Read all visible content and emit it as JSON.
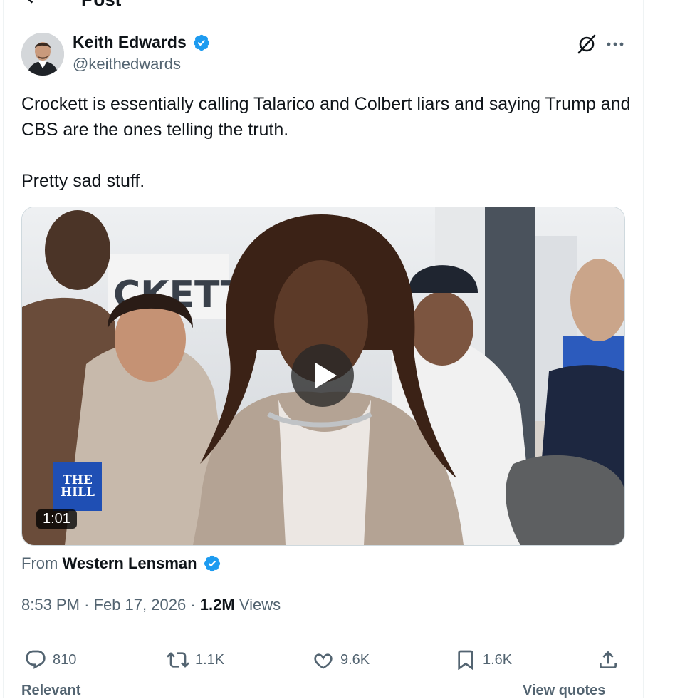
{
  "header": {
    "title": "Post",
    "back_icon": "back-arrow-icon"
  },
  "post": {
    "author": {
      "name": "Keith Edwards",
      "handle": "@keithedwards",
      "verified": true
    },
    "text": [
      "Crockett is essentially calling Talarico and Colbert liars and saying Trump and CBS are the ones telling the truth.",
      "Pretty sad stuff."
    ],
    "media": {
      "type": "video",
      "duration": "1:01",
      "watermark": "THE HILL",
      "sign_text": "CKETT"
    },
    "attribution": {
      "prefix": "From",
      "source": "Western Lensman",
      "verified": true
    },
    "meta": {
      "time": "8:53 PM",
      "separator": "·",
      "date": "Feb 17, 2026",
      "views_count": "1.2M",
      "views_label": "Views"
    },
    "actions": {
      "replies": "810",
      "reposts": "1.1K",
      "likes": "9.6K",
      "bookmarks": "1.6K"
    },
    "below": {
      "left": "Relevant",
      "right": "View quotes"
    }
  },
  "colors": {
    "verified": "#1d9bf0",
    "secondary_text": "#536471",
    "text": "#0f1419"
  }
}
